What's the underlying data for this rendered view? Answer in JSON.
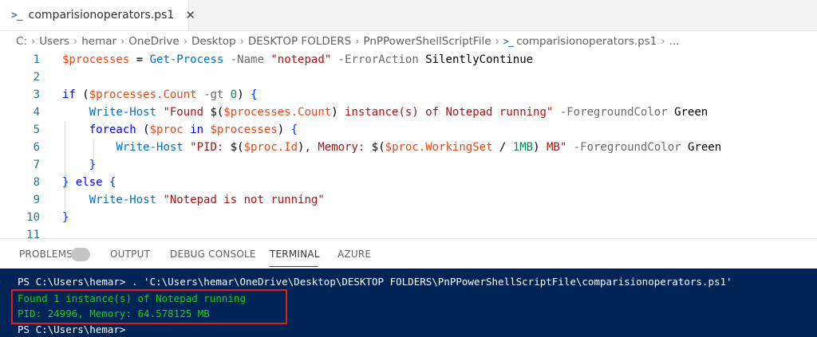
{
  "tab": {
    "icon": "powershell-icon",
    "label": "comparisionoperators.ps1",
    "close_glyph": "✕"
  },
  "breadcrumb": {
    "segments": [
      "C:",
      "Users",
      "hemar",
      "OneDrive",
      "Desktop",
      "DESKTOP FOLDERS",
      "PnPPowerShellScriptFile",
      "comparisionoperators.ps1",
      "..."
    ],
    "separator": "›",
    "file_icon": "powershell-icon"
  },
  "editor": {
    "line_numbers": [
      "1",
      "2",
      "3",
      "4",
      "5",
      "6",
      "7",
      "8",
      "9",
      "10",
      "11"
    ],
    "lines": [
      [
        {
          "c": "t-var",
          "t": "$processes"
        },
        {
          "c": "t-plain",
          "t": " = "
        },
        {
          "c": "t-cmd",
          "t": "Get-Process"
        },
        {
          "c": "t-plain",
          "t": " "
        },
        {
          "c": "t-param",
          "t": "-Name"
        },
        {
          "c": "t-plain",
          "t": " "
        },
        {
          "c": "t-str",
          "t": "\"notepad\""
        },
        {
          "c": "t-plain",
          "t": " "
        },
        {
          "c": "t-param",
          "t": "-ErrorAction"
        },
        {
          "c": "t-plain",
          "t": " SilentlyContinue"
        }
      ],
      [],
      [
        {
          "c": "t-kw",
          "t": "if"
        },
        {
          "c": "t-plain",
          "t": " ("
        },
        {
          "c": "t-var",
          "t": "$processes"
        },
        {
          "c": "t-var",
          "t": ".Count"
        },
        {
          "c": "t-plain",
          "t": " "
        },
        {
          "c": "t-param",
          "t": "-gt"
        },
        {
          "c": "t-plain",
          "t": " "
        },
        {
          "c": "t-num",
          "t": "0"
        },
        {
          "c": "t-plain",
          "t": ") "
        },
        {
          "c": "t-brace",
          "t": "{"
        }
      ],
      [
        {
          "c": "t-plain",
          "t": "    "
        },
        {
          "c": "t-cmd",
          "t": "Write-Host"
        },
        {
          "c": "t-plain",
          "t": " "
        },
        {
          "c": "t-str",
          "t": "\"Found "
        },
        {
          "c": "t-plain",
          "t": "$("
        },
        {
          "c": "t-var",
          "t": "$processes.Count"
        },
        {
          "c": "t-plain",
          "t": ")"
        },
        {
          "c": "t-str",
          "t": " instance(s) of Notepad running\""
        },
        {
          "c": "t-plain",
          "t": " "
        },
        {
          "c": "t-param",
          "t": "-ForegroundColor"
        },
        {
          "c": "t-plain",
          "t": " Green"
        }
      ],
      [
        {
          "c": "t-plain",
          "t": "    "
        },
        {
          "c": "t-kw",
          "t": "foreach"
        },
        {
          "c": "t-plain",
          "t": " ("
        },
        {
          "c": "t-var",
          "t": "$proc"
        },
        {
          "c": "t-plain",
          "t": " "
        },
        {
          "c": "t-kw",
          "t": "in"
        },
        {
          "c": "t-plain",
          "t": " "
        },
        {
          "c": "t-var",
          "t": "$processes"
        },
        {
          "c": "t-plain",
          "t": ") "
        },
        {
          "c": "t-brace",
          "t": "{"
        }
      ],
      [
        {
          "c": "t-plain",
          "t": "        "
        },
        {
          "c": "t-cmd",
          "t": "Write-Host"
        },
        {
          "c": "t-plain",
          "t": " "
        },
        {
          "c": "t-str",
          "t": "\"PID: "
        },
        {
          "c": "t-plain",
          "t": "$("
        },
        {
          "c": "t-var",
          "t": "$proc.Id"
        },
        {
          "c": "t-plain",
          "t": ")"
        },
        {
          "c": "t-str",
          "t": ", Memory: "
        },
        {
          "c": "t-plain",
          "t": "$("
        },
        {
          "c": "t-var",
          "t": "$proc.WorkingSet"
        },
        {
          "c": "t-plain",
          "t": " / "
        },
        {
          "c": "t-num",
          "t": "1MB"
        },
        {
          "c": "t-plain",
          "t": ")"
        },
        {
          "c": "t-str",
          "t": " MB\""
        },
        {
          "c": "t-plain",
          "t": " "
        },
        {
          "c": "t-param",
          "t": "-ForegroundColor"
        },
        {
          "c": "t-plain",
          "t": " Green"
        }
      ],
      [
        {
          "c": "t-plain",
          "t": "    "
        },
        {
          "c": "t-brace",
          "t": "}"
        }
      ],
      [
        {
          "c": "t-brace",
          "t": "}"
        },
        {
          "c": "t-plain",
          "t": " "
        },
        {
          "c": "t-kw",
          "t": "else"
        },
        {
          "c": "t-plain",
          "t": " "
        },
        {
          "c": "t-brace",
          "t": "{"
        }
      ],
      [
        {
          "c": "t-plain",
          "t": "    "
        },
        {
          "c": "t-cmd",
          "t": "Write-Host"
        },
        {
          "c": "t-plain",
          "t": " "
        },
        {
          "c": "t-str",
          "t": "\"Notepad is not running\""
        }
      ],
      [
        {
          "c": "t-brace",
          "t": "}"
        }
      ],
      []
    ]
  },
  "panel": {
    "tabs": [
      "PROBLEMS",
      "OUTPUT",
      "DEBUG CONSOLE",
      "TERMINAL",
      "AZURE"
    ],
    "active": "TERMINAL"
  },
  "terminal": {
    "command_line": "PS C:\\Users\\hemar> . 'C:\\Users\\hemar\\OneDrive\\Desktop\\DESKTOP FOLDERS\\PnPPowerShellScriptFile\\comparisionoperators.ps1'",
    "output_1": "Found 1 instance(s) of Notepad running",
    "output_2": "PID: 24996, Memory: 64.578125 MB",
    "prompt": "PS C:\\Users\\hemar>"
  },
  "colors": {
    "terminal_bg": "#012456",
    "terminal_output": "#1ecb1e",
    "highlight_box": "#e21b1b"
  }
}
